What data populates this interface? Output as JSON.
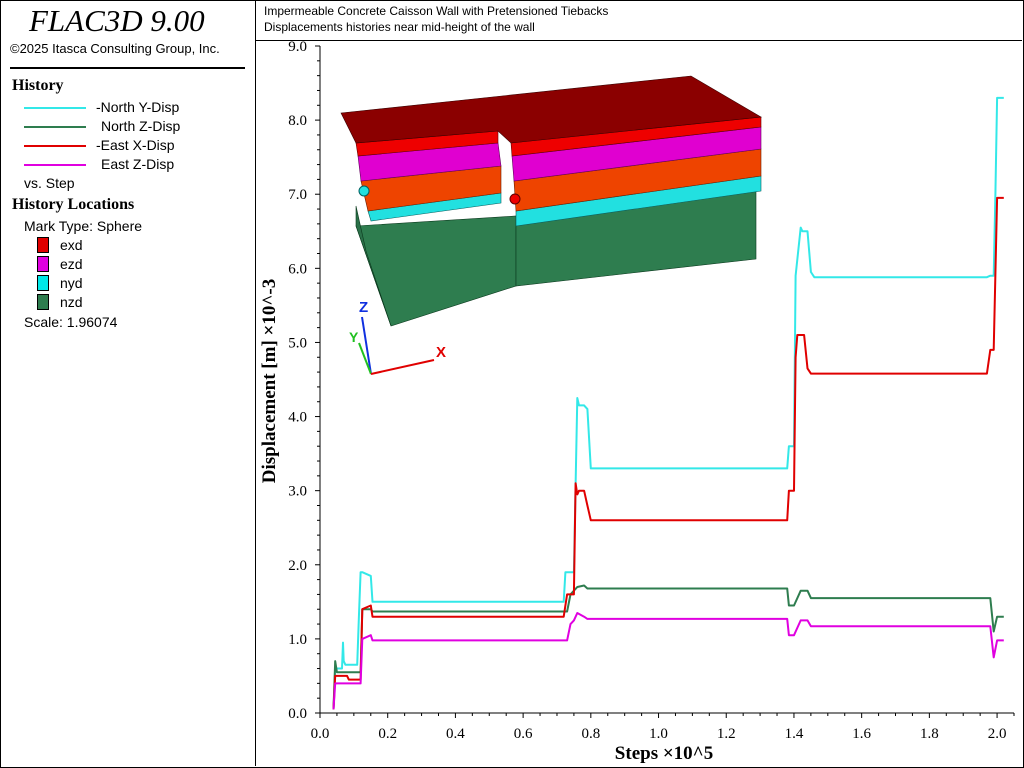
{
  "app": {
    "title": "FLAC3D 9.00",
    "copyright": "©2025 Itasca Consulting Group, Inc."
  },
  "header": {
    "line1": "Impermeable Concrete Caisson Wall with Pretensioned Tiebacks",
    "line2": "Displacements histories near mid-height of the wall"
  },
  "history": {
    "heading": "History",
    "vs": "vs. Step",
    "items": [
      {
        "label": "-North Y-Disp",
        "color": "#33e8e8"
      },
      {
        "label": "North Z-Disp",
        "color": "#2e7d4f"
      },
      {
        "label": "-East X-Disp",
        "color": "#e00000"
      },
      {
        "label": "East Z-Disp",
        "color": "#e000e0"
      }
    ]
  },
  "locations": {
    "heading": "History Locations",
    "mark_type": "Mark Type: Sphere",
    "items": [
      {
        "label": "exd",
        "color": "#e00000"
      },
      {
        "label": "ezd",
        "color": "#e000e0"
      },
      {
        "label": "nyd",
        "color": "#00e8e8"
      },
      {
        "label": "nzd",
        "color": "#2e7d4f"
      }
    ],
    "scale": "Scale: 1.96074"
  },
  "model_view": {
    "axis_labels": {
      "x": "X",
      "y": "Y",
      "z": "Z"
    },
    "axis_colors": {
      "x": "#e00000",
      "y": "#20c020",
      "z": "#1030e0"
    },
    "layer_colors": {
      "top": "#8b0000",
      "red": "#ee0000",
      "magenta": "#e000d0",
      "orange": "#ee4400",
      "cyan": "#22e0e0",
      "green": "#2e7d4f"
    }
  },
  "chart_data": {
    "type": "line",
    "title": "",
    "xlabel": "Steps ×10^5",
    "ylabel": "Displacement [m] ×10^-3",
    "xlim": [
      0,
      2.05
    ],
    "ylim": [
      0,
      9.0
    ],
    "xticks": [
      "0.0",
      "0.2",
      "0.4",
      "0.6",
      "0.8",
      "1.0",
      "1.2",
      "1.4",
      "1.6",
      "1.8",
      "2.0"
    ],
    "yticks": [
      "0.0",
      "1.0",
      "2.0",
      "3.0",
      "4.0",
      "5.0",
      "6.0",
      "7.0",
      "8.0",
      "9.0"
    ],
    "grid": false,
    "series": [
      {
        "name": "-North Y-Disp",
        "color": "#33e8e8",
        "x": [
          0.04,
          0.045,
          0.05,
          0.065,
          0.068,
          0.07,
          0.075,
          0.08,
          0.09,
          0.11,
          0.115,
          0.12,
          0.125,
          0.15,
          0.155,
          0.16,
          0.3,
          0.5,
          0.72,
          0.725,
          0.74,
          0.75,
          0.76,
          0.765,
          0.78,
          0.79,
          0.8,
          1.0,
          1.2,
          1.38,
          1.385,
          1.4,
          1.405,
          1.42,
          1.425,
          1.44,
          1.45,
          1.46,
          1.7,
          1.97,
          1.98,
          1.99,
          1.995,
          2.0,
          2.02
        ],
        "y": [
          0.05,
          0.6,
          0.6,
          0.6,
          0.95,
          0.7,
          0.65,
          0.65,
          0.65,
          0.65,
          1.3,
          1.9,
          1.9,
          1.85,
          1.5,
          1.5,
          1.5,
          1.5,
          1.5,
          1.9,
          1.9,
          1.9,
          4.25,
          4.15,
          4.15,
          4.1,
          3.3,
          3.3,
          3.3,
          3.3,
          3.6,
          3.6,
          5.9,
          6.55,
          6.5,
          6.5,
          5.95,
          5.88,
          5.88,
          5.88,
          5.9,
          5.9,
          7.0,
          8.3,
          8.3
        ]
      },
      {
        "name": "North Z-Disp",
        "color": "#2e7d4f",
        "x": [
          0.04,
          0.045,
          0.05,
          0.08,
          0.12,
          0.125,
          0.15,
          0.155,
          0.3,
          0.5,
          0.73,
          0.74,
          0.75,
          0.76,
          0.78,
          0.79,
          1.0,
          1.2,
          1.38,
          1.385,
          1.4,
          1.42,
          1.44,
          1.45,
          1.7,
          1.97,
          1.98,
          1.99,
          2.0,
          2.02
        ],
        "y": [
          0.05,
          0.7,
          0.55,
          0.55,
          0.55,
          1.4,
          1.4,
          1.37,
          1.37,
          1.37,
          1.37,
          1.6,
          1.65,
          1.7,
          1.72,
          1.68,
          1.68,
          1.68,
          1.68,
          1.45,
          1.45,
          1.65,
          1.65,
          1.55,
          1.55,
          1.55,
          1.55,
          1.1,
          1.3,
          1.3
        ]
      },
      {
        "name": "-East X-Disp",
        "color": "#e00000",
        "x": [
          0.04,
          0.045,
          0.05,
          0.08,
          0.085,
          0.12,
          0.125,
          0.15,
          0.155,
          0.3,
          0.5,
          0.72,
          0.73,
          0.75,
          0.755,
          0.76,
          0.765,
          0.78,
          0.79,
          0.8,
          1.0,
          1.2,
          1.38,
          1.385,
          1.4,
          1.405,
          1.41,
          1.43,
          1.44,
          1.45,
          1.7,
          1.97,
          1.98,
          1.99,
          2.0,
          2.02
        ],
        "y": [
          0.05,
          0.5,
          0.5,
          0.5,
          0.45,
          0.45,
          1.4,
          1.45,
          1.3,
          1.3,
          1.3,
          1.3,
          1.6,
          1.6,
          3.1,
          2.95,
          3.0,
          3.0,
          2.8,
          2.6,
          2.6,
          2.6,
          2.6,
          3.0,
          3.0,
          4.8,
          5.1,
          5.1,
          4.65,
          4.58,
          4.58,
          4.58,
          4.9,
          4.9,
          6.95,
          6.95
        ]
      },
      {
        "name": "East Z-Disp",
        "color": "#e000e0",
        "x": [
          0.04,
          0.045,
          0.05,
          0.08,
          0.12,
          0.125,
          0.15,
          0.155,
          0.3,
          0.5,
          0.73,
          0.74,
          0.75,
          0.76,
          0.78,
          0.79,
          1.0,
          1.2,
          1.38,
          1.385,
          1.4,
          1.42,
          1.44,
          1.45,
          1.7,
          1.97,
          1.98,
          1.99,
          2.0,
          2.02
        ],
        "y": [
          0.05,
          0.4,
          0.4,
          0.4,
          0.4,
          1.0,
          1.05,
          0.98,
          0.98,
          0.98,
          0.98,
          1.2,
          1.25,
          1.35,
          1.3,
          1.27,
          1.27,
          1.27,
          1.27,
          1.05,
          1.05,
          1.25,
          1.25,
          1.17,
          1.17,
          1.17,
          1.17,
          0.75,
          0.98,
          0.98
        ]
      }
    ]
  }
}
